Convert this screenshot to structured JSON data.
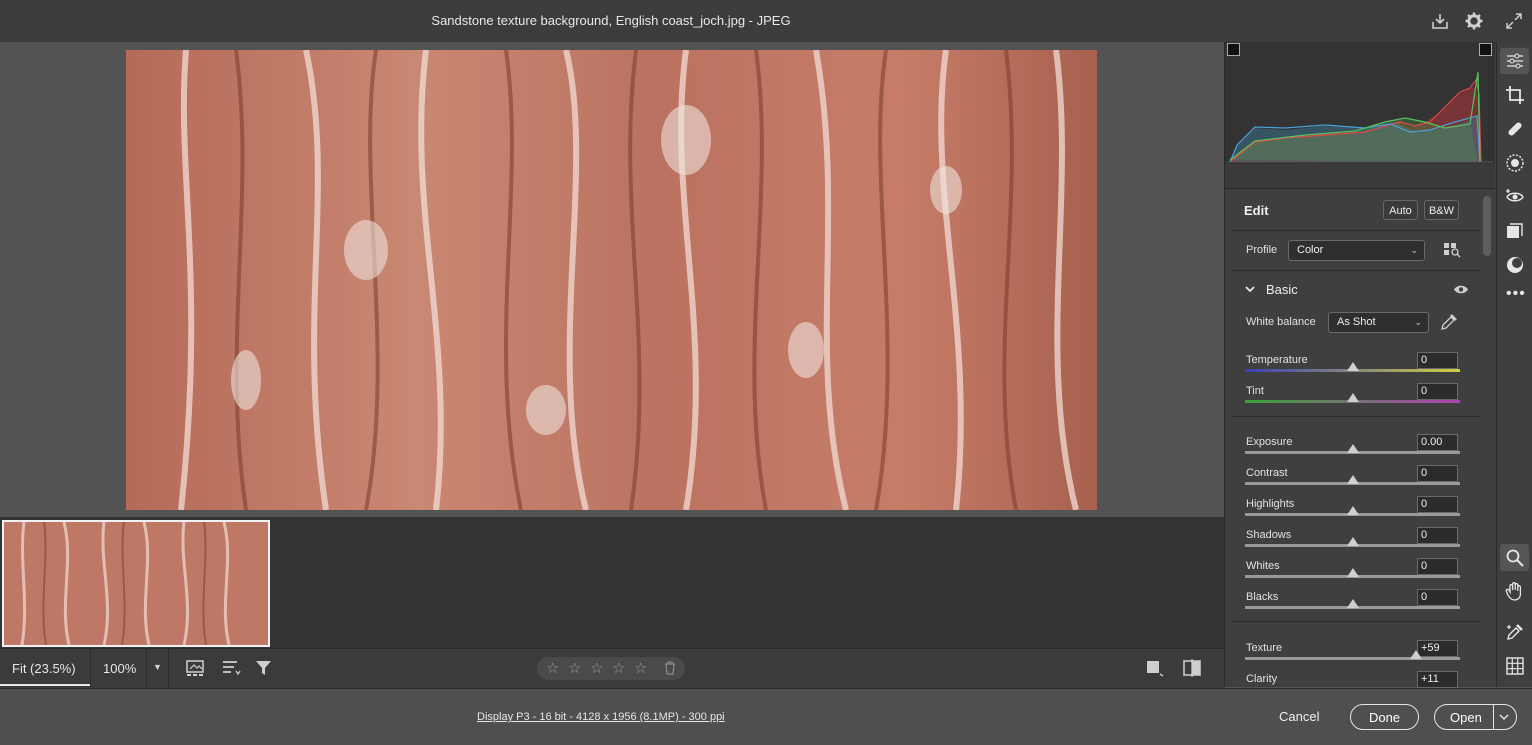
{
  "window": {
    "title": "Sandstone texture background, English coast_joch.jpg  -  JPEG"
  },
  "titlebar_icons": [
    "save-icon",
    "gear-icon",
    "fullscreen-icon"
  ],
  "viewbar": {
    "fit_label": "Fit (23.5%)",
    "zoom_label": "100%",
    "rating_stars": 0
  },
  "footer": {
    "file_info": "Display P3 - 16 bit - 4128 x 1956 (8.1MP) - 300 ppi",
    "cancel": "Cancel",
    "done": "Done",
    "open": "Open"
  },
  "edit": {
    "title": "Edit",
    "auto": "Auto",
    "bw": "B&W",
    "profile_label": "Profile",
    "profile_value": "Color",
    "basic_title": "Basic",
    "wb_label": "White balance",
    "wb_value": "As Shot",
    "sliders": [
      {
        "label": "Temperature",
        "value": "0",
        "pos": 0.5
      },
      {
        "label": "Tint",
        "value": "0",
        "pos": 0.5
      },
      {
        "label": "Exposure",
        "value": "0.00",
        "pos": 0.5
      },
      {
        "label": "Contrast",
        "value": "0",
        "pos": 0.5
      },
      {
        "label": "Highlights",
        "value": "0",
        "pos": 0.5
      },
      {
        "label": "Shadows",
        "value": "0",
        "pos": 0.5
      },
      {
        "label": "Whites",
        "value": "0",
        "pos": 0.5
      },
      {
        "label": "Blacks",
        "value": "0",
        "pos": 0.5
      },
      {
        "label": "Texture",
        "value": "+59",
        "pos": 0.795
      },
      {
        "label": "Clarity",
        "value": "+11",
        "pos": 0.555
      }
    ]
  },
  "side_tools": [
    "edit-sliders-icon",
    "crop-icon",
    "heal-icon",
    "masking-icon",
    "redeye-icon",
    "presets-icon",
    "snapshots-icon",
    "more-icon",
    "zoom-icon",
    "hand-icon",
    "color-sampler-icon",
    "grid-icon"
  ],
  "colors": {
    "accent": "#e6e6e6",
    "panel_bg": "#3f3f3f",
    "canvas_bg": "#535353"
  }
}
